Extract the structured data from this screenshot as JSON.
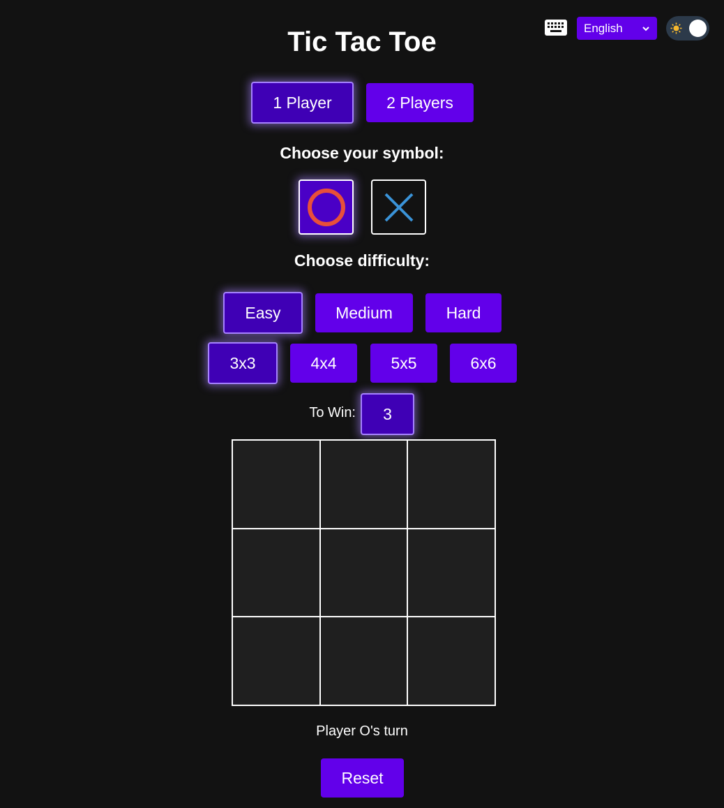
{
  "header": {
    "keyboard_icon": "keyboard-icon",
    "language": {
      "selected": "English",
      "icon": "chevron-down-icon"
    },
    "theme_toggle": {
      "icon": "sun-icon",
      "state": "dark"
    }
  },
  "title": "Tic Tac Toe",
  "modes": [
    {
      "label": "1 Player",
      "active": true
    },
    {
      "label": "2 Players",
      "active": false
    }
  ],
  "symbol": {
    "label": "Choose your symbol:",
    "options": [
      {
        "name": "O",
        "icon": "circle-o-icon",
        "color": "#e8503a",
        "active": true
      },
      {
        "name": "X",
        "icon": "cross-x-icon",
        "color": "#3a93d8",
        "active": false
      }
    ]
  },
  "difficulty": {
    "label": "Choose difficulty:",
    "options": [
      {
        "label": "Easy",
        "active": true
      },
      {
        "label": "Medium",
        "active": false
      },
      {
        "label": "Hard",
        "active": false
      }
    ]
  },
  "sizes": [
    {
      "label": "3x3",
      "active": true
    },
    {
      "label": "4x4",
      "active": false
    },
    {
      "label": "5x5",
      "active": false
    },
    {
      "label": "6x6",
      "active": false
    }
  ],
  "to_win": {
    "label": "To Win:",
    "value": "3"
  },
  "board": {
    "size": 3,
    "cells": [
      "",
      "",
      "",
      "",
      "",
      "",
      "",
      "",
      ""
    ]
  },
  "status": "Player O's turn",
  "reset_label": "Reset",
  "colors": {
    "background": "#121212",
    "accent": "#6200ea",
    "accent_active": "#3f00b5",
    "glow": "#a682ff",
    "cell": "#1f1f1f"
  }
}
